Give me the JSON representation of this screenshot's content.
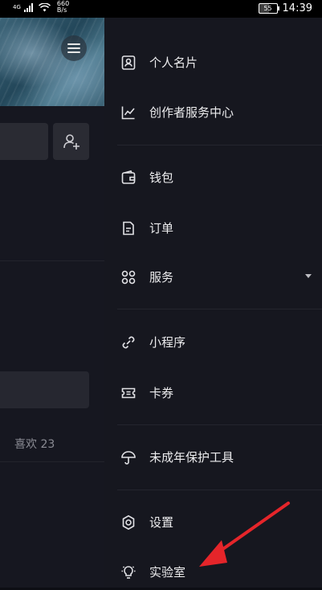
{
  "status_bar": {
    "signal_label": "4G",
    "speed_value": "660",
    "speed_unit": "B/s",
    "battery": "55",
    "time": "14:39"
  },
  "background_page": {
    "likes_label": "喜欢 23"
  },
  "drawer": {
    "items": [
      {
        "label": "个人名片",
        "icon": "id-card-icon"
      },
      {
        "label": "创作者服务中心",
        "icon": "trend-chart-icon"
      },
      {
        "label": "钱包",
        "icon": "wallet-icon"
      },
      {
        "label": "订单",
        "icon": "order-document-icon"
      },
      {
        "label": "服务",
        "icon": "grid-services-icon"
      },
      {
        "label": "小程序",
        "icon": "mini-program-link-icon"
      },
      {
        "label": "卡券",
        "icon": "coupon-ticket-icon"
      },
      {
        "label": "未成年保护工具",
        "icon": "umbrella-icon"
      },
      {
        "label": "设置",
        "icon": "gear-icon"
      },
      {
        "label": "实验室",
        "icon": "lightbulb-icon"
      }
    ]
  },
  "colors": {
    "drawer_bg": "#16171f",
    "annotation_arrow": "#e5252a"
  }
}
